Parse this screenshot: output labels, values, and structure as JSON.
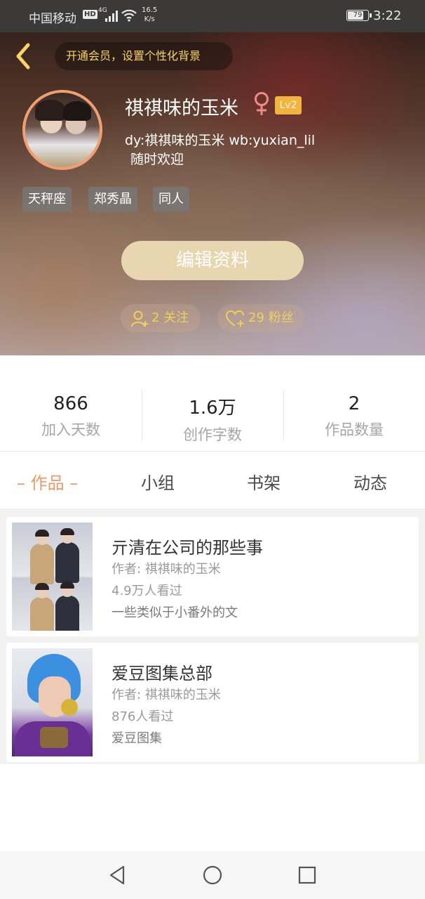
{
  "status_bar": {
    "carrier": "中国移动",
    "hd": "HD",
    "network": "4G",
    "speed_value": "16.5",
    "speed_unit": "K/s",
    "battery": "79",
    "time": "3:22"
  },
  "header": {
    "vip_prompt": "开通会员，设置个性化背景",
    "username": "祺祺味的玉米",
    "level": "Lv2",
    "bio_line1": "dy:祺祺味的玉米 wb:yuxian_lil",
    "bio_line2": "随时欢迎",
    "tags": [
      "天秤座",
      "郑秀晶",
      "同人"
    ],
    "edit_button": "编辑资料",
    "following": "2 关注",
    "followers": "29 粉丝"
  },
  "stats": [
    {
      "value": "866",
      "label": "加入天数"
    },
    {
      "value": "1.6万",
      "label": "创作字数"
    },
    {
      "value": "2",
      "label": "作品数量"
    }
  ],
  "tabs": [
    {
      "label": "– 作品 –",
      "active": true
    },
    {
      "label": "小组",
      "active": false
    },
    {
      "label": "书架",
      "active": false
    },
    {
      "label": "动态",
      "active": false
    }
  ],
  "works": [
    {
      "title": "亓清在公司的那些事",
      "author": "作者: 祺祺味的玉米",
      "views": "4.9万人看过",
      "description": "一些类似于小番外的文"
    },
    {
      "title": "爱豆图集总部",
      "author": "作者: 祺祺味的玉米",
      "views": "876人看过",
      "description": "爱豆图集"
    }
  ],
  "colors": {
    "accent": "#e79b6b",
    "gold": "#f1cf5c",
    "level_badge": "#f2b341",
    "edit_button_bg": "#e8d6b0",
    "female_icon": "#f08a8a"
  },
  "icons": {
    "back": "chevron-left-icon",
    "gender": "female-icon",
    "following": "user-add-icon",
    "followers": "heart-add-icon",
    "nav_back": "triangle-back-icon",
    "nav_home": "circle-home-icon",
    "nav_recent": "square-recent-icon"
  }
}
